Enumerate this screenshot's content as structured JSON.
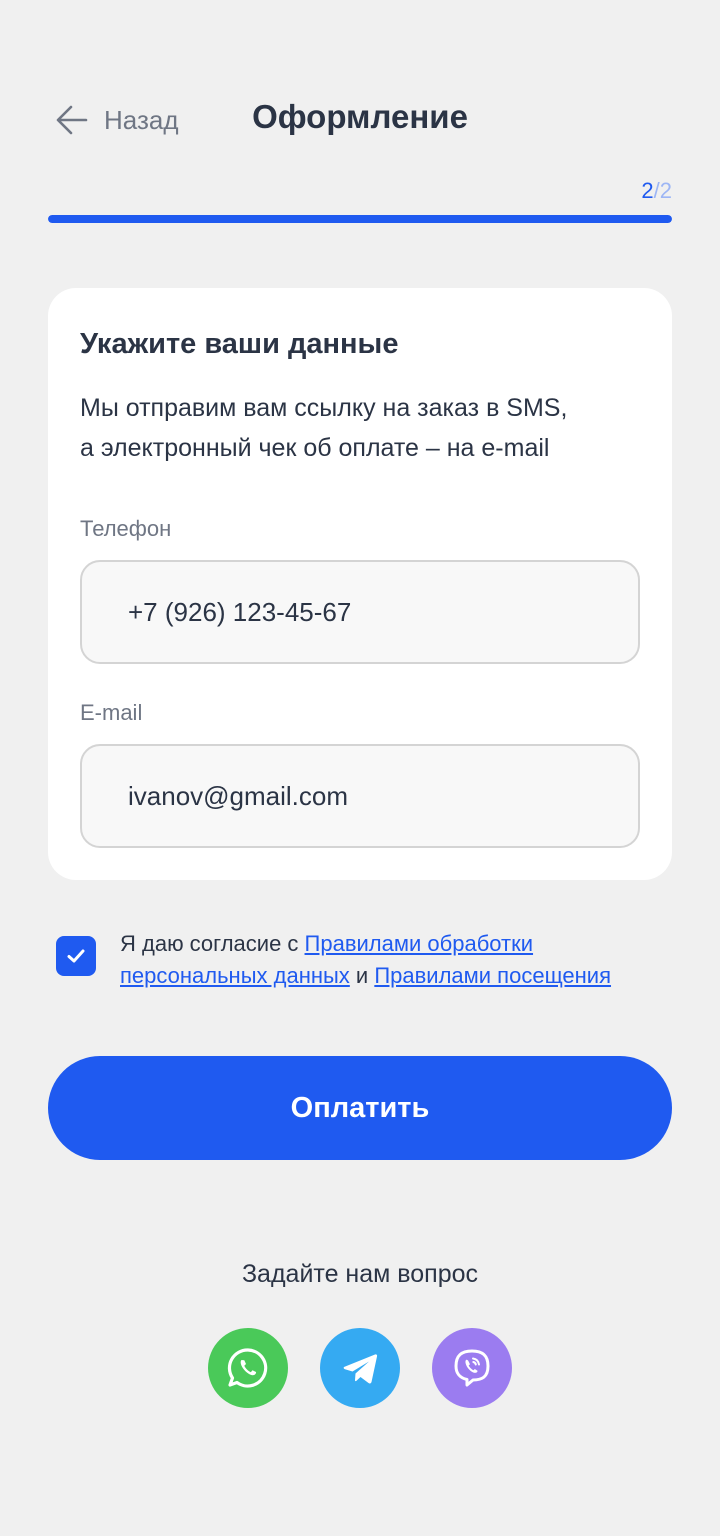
{
  "header": {
    "back_label": "Назад",
    "title": "Оформление",
    "step_current": "2",
    "step_separator": "/",
    "step_total": "2",
    "progress": 1.0
  },
  "card": {
    "title": "Укажите ваши данные",
    "description_line1": "Мы отправим вам ссылку на заказ в SMS,",
    "description_line2": "а электронный чек об оплате – на e-mail",
    "phone_label": "Телефон",
    "phone_value": "+7 (926) 123-45-67",
    "email_label": "E-mail",
    "email_value": "ivanov@gmail.com"
  },
  "consent": {
    "checked": true,
    "text_before": "Я даю согласие с ",
    "link1": "Правилами обработки персональных данных",
    "text_middle": " и ",
    "link2": "Правилами посещения"
  },
  "pay_button_label": "Оплатить",
  "support": {
    "title": "Задайте нам вопрос",
    "messengers": [
      {
        "icon": "whatsapp-icon",
        "color": "#4ac959"
      },
      {
        "icon": "telegram-icon",
        "color": "#35aaf2"
      },
      {
        "icon": "viber-icon",
        "color": "#9b7cf0"
      }
    ]
  },
  "colors": {
    "accent": "#1f5af0",
    "background": "#f0f0f0",
    "text": "#2b3445",
    "muted": "#6f7684"
  }
}
